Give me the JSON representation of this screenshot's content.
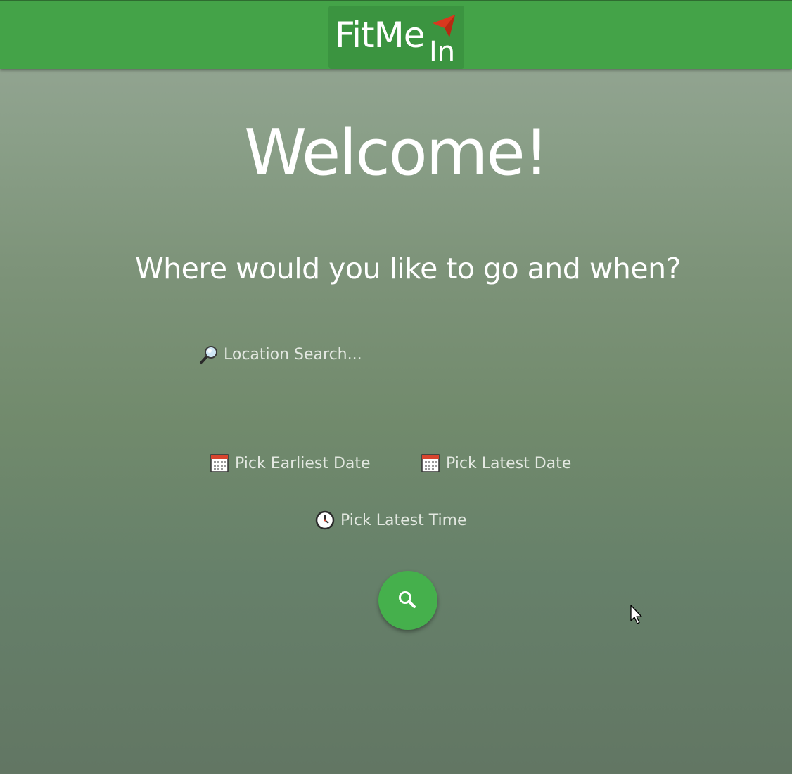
{
  "header": {
    "logo_main": "FitMe",
    "logo_sub": "In",
    "logo_icon": "red-arrow-icon",
    "bar_color": "#44a348"
  },
  "main": {
    "heading": "Welcome!",
    "subtitle": "Where would you like to go and when?"
  },
  "form": {
    "location_placeholder": "Location Search...",
    "location_value": "",
    "location_icon": "magnifier-icon",
    "earliest_date_placeholder": "Pick Earliest Date",
    "latest_date_placeholder": "Pick Latest Date",
    "date_icon": "calendar-icon",
    "latest_time_placeholder": "Pick Latest Time",
    "time_icon": "clock-icon",
    "search_button_icon": "search-icon",
    "search_button_color": "#45b04c"
  }
}
